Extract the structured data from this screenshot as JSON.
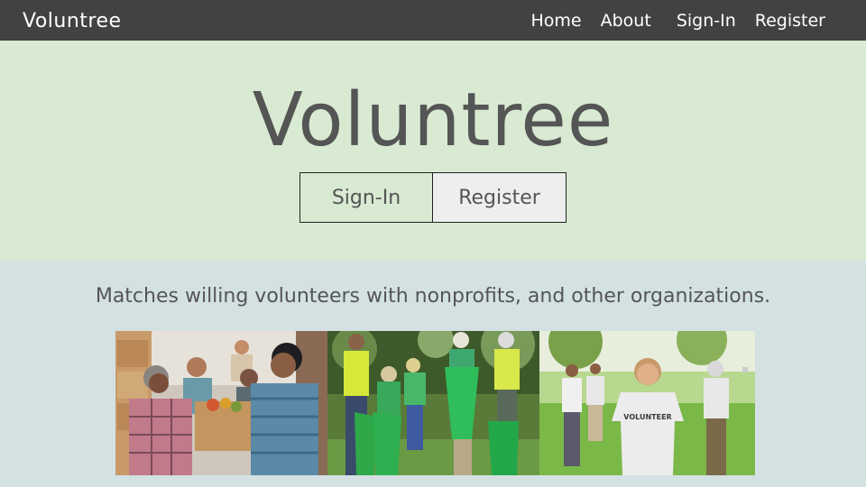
{
  "navbar": {
    "brand": "Voluntree",
    "links": [
      {
        "label": "Home"
      },
      {
        "label": "About"
      },
      {
        "label": "Sign-In"
      },
      {
        "label": "Register"
      }
    ]
  },
  "hero": {
    "title": "Voluntree",
    "buttons": {
      "signin": "Sign-In",
      "register": "Register"
    }
  },
  "tagline": "Matches willing volunteers with nonprofits, and other organizations.",
  "photos": {
    "shirt_text": "VOLUNTEER"
  },
  "colors": {
    "navbar_bg": "#424242",
    "hero_bg": "#d9ead3",
    "section_bg": "#d3e1e3",
    "text_gray": "#555555"
  }
}
